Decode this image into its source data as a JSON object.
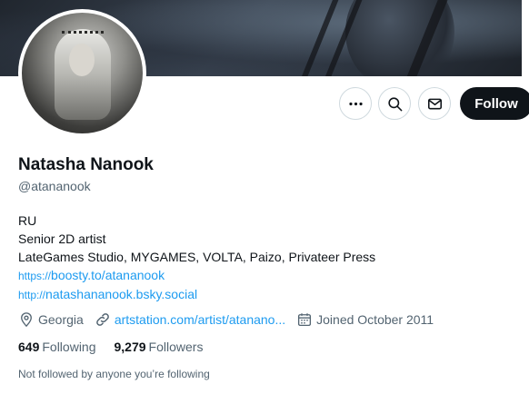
{
  "profile": {
    "name": "Natasha Nanook",
    "handle": "@atananook",
    "bio_lines": [
      "RU",
      "Senior 2D artist",
      "LateGames Studio, MYGAMES, VOLTA, Paizo, Privateer Press"
    ],
    "links": [
      {
        "proto": "https://",
        "text": "boosty.to/atananook"
      },
      {
        "proto": "http://",
        "text": "natashananook.bsky.social"
      }
    ],
    "location": "Georgia",
    "website": "artstation.com/artist/atanano...",
    "joined": "Joined October 2011"
  },
  "counts": {
    "following_value": "649",
    "following_label": "Following",
    "followers_value": "9,279",
    "followers_label": "Followers"
  },
  "followed_by_text": "Not followed by anyone you’re following",
  "actions": {
    "more_icon": "more-icon",
    "search_icon": "search-icon",
    "message_icon": "envelope-icon",
    "follow_label": "Follow"
  },
  "colors": {
    "accent": "#1d9bf0",
    "primary_text": "#0f1419",
    "secondary_text": "#536471",
    "button_dark": "#0f1419",
    "border": "#cfd9de"
  }
}
